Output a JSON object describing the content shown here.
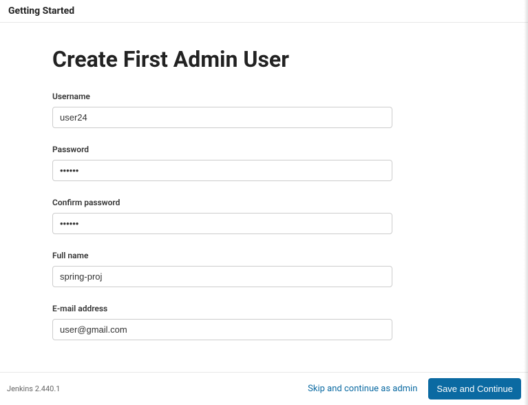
{
  "header": {
    "title": "Getting Started"
  },
  "page": {
    "title": "Create First Admin User"
  },
  "form": {
    "username": {
      "label": "Username",
      "value": "user24"
    },
    "password": {
      "label": "Password",
      "value": "••••••"
    },
    "confirm_password": {
      "label": "Confirm password",
      "value": "••••••"
    },
    "full_name": {
      "label": "Full name",
      "value": "spring-proj"
    },
    "email": {
      "label": "E-mail address",
      "value": "user@gmail.com"
    }
  },
  "footer": {
    "version": "Jenkins 2.440.1",
    "skip_label": "Skip and continue as admin",
    "save_label": "Save and Continue"
  }
}
